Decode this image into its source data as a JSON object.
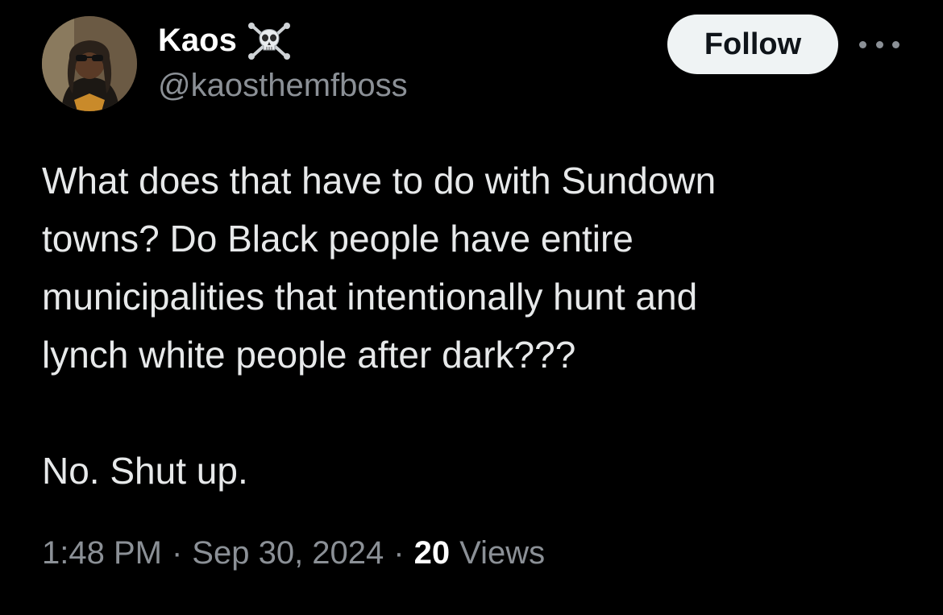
{
  "author": {
    "display_name": "Kaos",
    "handle": "@kaosthemfboss",
    "name_emoji_icon": "skull-and-crossbones-icon",
    "avatar": "profile-photo"
  },
  "actions": {
    "follow_label": "Follow",
    "more_icon": "more-dots-icon"
  },
  "tweet": {
    "text": "What does that have to do with Sundown\ntowns? Do Black people have entire\nmunicipalities that intentionally hunt and\nlynch white people after dark???\n\nNo. Shut up."
  },
  "meta": {
    "time": "1:48 PM",
    "separator": "·",
    "date": "Sep 30, 2024",
    "views_count": "20",
    "views_label": "Views"
  },
  "colors": {
    "background": "#000000",
    "primary_text": "#e7e9ea",
    "secondary_text": "#8b9096",
    "follow_bg": "#eff3f4",
    "follow_text": "#0f1419"
  }
}
